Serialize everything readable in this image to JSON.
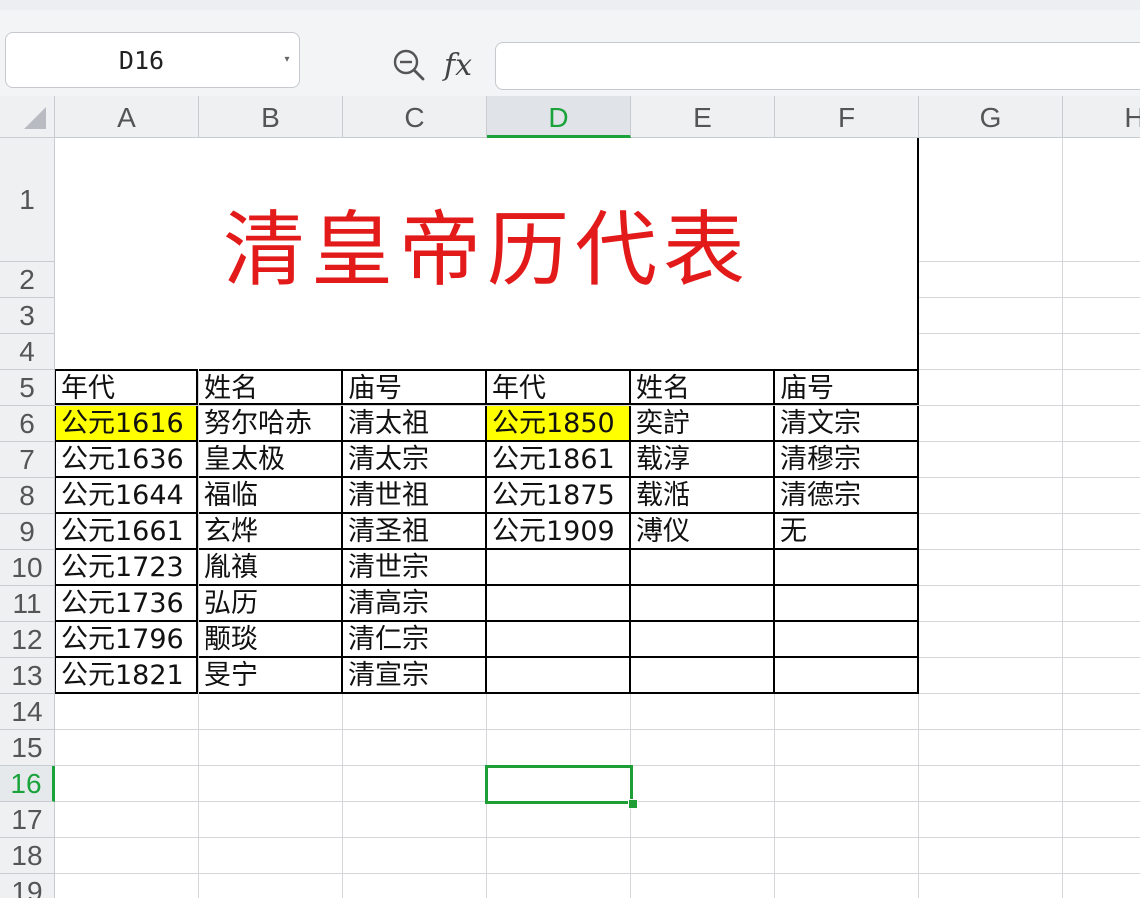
{
  "formula_bar": {
    "name_box": "D16",
    "fx_label": "fx",
    "formula_value": ""
  },
  "columns": [
    "A",
    "B",
    "C",
    "D",
    "E",
    "F",
    "G",
    "H"
  ],
  "active_column": "D",
  "rows": [
    "1",
    "2",
    "3",
    "4",
    "5",
    "6",
    "7",
    "8",
    "9",
    "10",
    "11",
    "12",
    "13",
    "14",
    "15",
    "16",
    "17",
    "18",
    "19"
  ],
  "active_row": "16",
  "sheet": {
    "title": "清皇帝历代表",
    "title_color": "#e31a1a",
    "highlight_color": "#ffff00",
    "selection_color": "#1f9e35",
    "header": [
      "年代",
      "姓名",
      "庙号",
      "年代",
      "姓名",
      "庙号"
    ],
    "table_rows": [
      [
        "公元1616",
        "努尔哈赤",
        "清太祖",
        "公元1850",
        "奕詝",
        "清文宗"
      ],
      [
        "公元1636",
        "皇太极",
        "清太宗",
        "公元1861",
        "载淳",
        "清穆宗"
      ],
      [
        "公元1644",
        "福临",
        "清世祖",
        "公元1875",
        "载湉",
        "清德宗"
      ],
      [
        "公元1661",
        "玄烨",
        "清圣祖",
        "公元1909",
        "溥仪",
        "无"
      ],
      [
        "公元1723",
        "胤禛",
        "清世宗",
        "",
        "",
        ""
      ],
      [
        "公元1736",
        "弘历",
        "清高宗",
        "",
        "",
        ""
      ],
      [
        "公元1796",
        "颙琰",
        "清仁宗",
        "",
        "",
        ""
      ],
      [
        "公元1821",
        "旻宁",
        "清宣宗",
        "",
        "",
        ""
      ]
    ],
    "highlighted_cells": [
      "A6",
      "D6"
    ]
  }
}
